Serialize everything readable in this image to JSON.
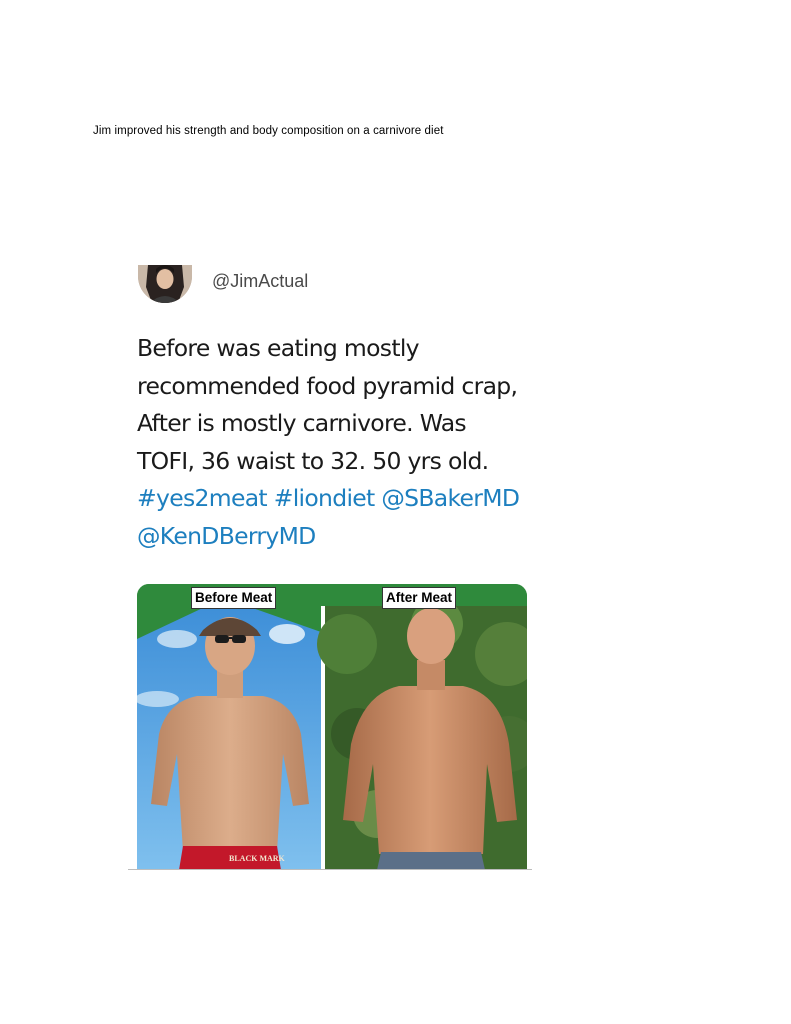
{
  "caption": "Jim improved his strength and body composition on a carnivore diet",
  "tweet": {
    "handle": "@JimActual",
    "line1": "Before was eating mostly",
    "line2": "recommended food pyramid crap,",
    "line3": "After is mostly carnivore.  Was",
    "line4": "TOFI, 36 waist to 32.  50 yrs old.",
    "hashtag1": "#yes2meat",
    "hashtag2": "#liondiet",
    "mention1": "@SBakerMD",
    "mention2": "@KenDBerryMD"
  },
  "photo": {
    "before_label": "Before Meat",
    "after_label": "After Meat",
    "shorts_brand": "BLACK MARK"
  },
  "colors": {
    "link": "#1d7fbf",
    "frame_green": "#2f8a3c",
    "sky": "#4f9fe0",
    "shorts_red": "#c3182a"
  }
}
